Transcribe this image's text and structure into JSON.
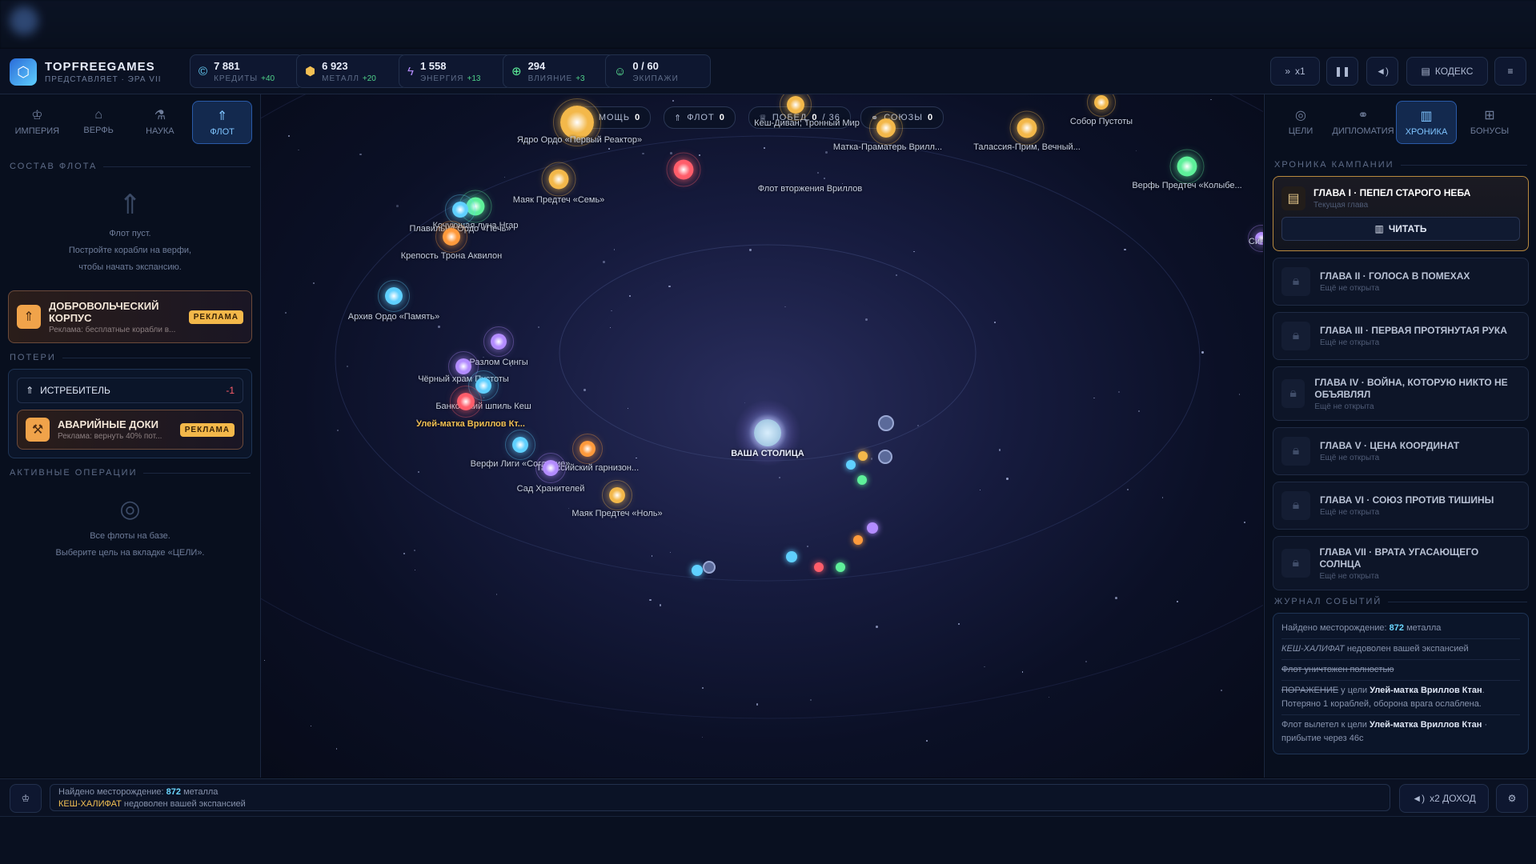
{
  "header": {
    "brand": "TOPFREEGAMES",
    "brand_sub": "ПРЕДСТАВЛЯЕТ · ЭРА VII",
    "resources": [
      {
        "icon": "credits-icon",
        "value": "7 881",
        "label": "КРЕДИТЫ",
        "delta": "+40",
        "color": "#6ad6ff"
      },
      {
        "icon": "metal-icon",
        "value": "6 923",
        "label": "МЕТАЛЛ",
        "delta": "+20",
        "color": "#f3c053"
      },
      {
        "icon": "energy-icon",
        "value": "1 558",
        "label": "ЭНЕРГИЯ",
        "delta": "+13",
        "color": "#b38cff"
      },
      {
        "icon": "influence-icon",
        "value": "294",
        "label": "ВЛИЯНИЕ",
        "delta": "+3",
        "color": "#5ef09a"
      },
      {
        "icon": "crews-icon",
        "value": "0 / 60",
        "label": "ЭКИПАЖИ",
        "delta": "",
        "color": "#5ef09a"
      }
    ],
    "speed": "x1",
    "codex": "КОДЕКС"
  },
  "left": {
    "tabs": [
      {
        "label": "ИМПЕРИЯ",
        "icon": "crown-icon",
        "active": false
      },
      {
        "label": "ВЕРФЬ",
        "icon": "shipyard-icon",
        "active": false
      },
      {
        "label": "НАУКА",
        "icon": "flask-icon",
        "active": false
      },
      {
        "label": "ФЛОТ",
        "icon": "rocket-icon",
        "active": true
      }
    ],
    "fleet_title": "СОСТАВ ФЛОТА",
    "fleet_empty": [
      "Флот пуст.",
      "Постройте корабли на верфи,",
      "чтобы начать экспансию."
    ],
    "promo": {
      "title": "ДОБРОВОЛЬЧЕСКИЙ КОРПУС",
      "sub": "Реклама: бесплатные корабли в...",
      "badge": "РЕКЛАМА"
    },
    "losses_title": "ПОТЕРИ",
    "loss": {
      "name": "ИСТРЕБИТЕЛЬ",
      "count": "-1"
    },
    "docks": {
      "title": "АВАРИЙНЫЕ ДОКИ",
      "sub": "Реклама: вернуть 40% пот...",
      "badge": "РЕКЛАМА"
    },
    "ops_title": "АКТИВНЫЕ ОПЕРАЦИИ",
    "ops_empty": [
      "Все флоты на базе.",
      "Выберите цель на вкладке «ЦЕЛИ»."
    ]
  },
  "map": {
    "chips": [
      {
        "label": "МОЩЬ",
        "value": "0",
        "extra": ""
      },
      {
        "label": "ФЛОТ",
        "value": "0",
        "extra": ""
      },
      {
        "label": "ПОБЕД",
        "value": "0",
        "extra": "/ 36"
      },
      {
        "label": "СОЮЗЫ",
        "value": "0",
        "extra": ""
      }
    ],
    "capital": "ВАША СТОЛИЦА",
    "nodes": [
      {
        "label": "Кеш-Диван, Тронный Мир",
        "color": "#f3b84a"
      },
      {
        "label": "Ядро Ордо «Первый Реактор»",
        "color": "#f3b84a"
      },
      {
        "label": "Собор Пустоты",
        "color": "#f3b84a"
      },
      {
        "label": "Матка-Праматерь Врилл...",
        "color": "#f3b84a"
      },
      {
        "label": "Талассия-Прим, Вечный...",
        "color": "#f3b84a"
      },
      {
        "label": "Верфь Предтеч «Колыбе...",
        "color": "#5ef09a"
      },
      {
        "label": "Флот вторжения Вриллов",
        "color": "#ff5d6a"
      },
      {
        "label": "Маяк Предтеч «Семь»",
        "color": "#f3b84a"
      },
      {
        "label": "Кочующая луна Нгар",
        "color": "#5ef09a"
      },
      {
        "label": "Плавильня Ордо «Печь»",
        "color": "#5fd0ff"
      },
      {
        "label": "Крепость Трона Аквилон",
        "color": "#ff9a3c"
      },
      {
        "label": "Архив Ордо «Память»",
        "color": "#5fd0ff"
      },
      {
        "label": "Разлом Сингы",
        "color": "#b38cff"
      },
      {
        "label": "Чёрный храм Пустоты",
        "color": "#b38cff"
      },
      {
        "label": "Банковский шпиль Кеш",
        "color": "#5fd0ff"
      },
      {
        "label": "Улей-матка Вриллов Кт...",
        "color": "#ff5d6a"
      },
      {
        "label": "Верфи Лиги «Согласие»",
        "color": "#5fd0ff"
      },
      {
        "label": "Талассийский гарнизон...",
        "color": "#ff9a3c"
      },
      {
        "label": "Сад Хранителей",
        "color": "#b38cff"
      },
      {
        "label": "Маяк Предтеч «Ноль»",
        "color": "#f3b84a"
      },
      {
        "label": "Син",
        "color": "#b38cff"
      }
    ]
  },
  "right": {
    "tabs": [
      {
        "label": "ЦЕЛИ",
        "icon": "target-icon",
        "active": false
      },
      {
        "label": "ДИПЛОМАТИЯ",
        "icon": "handshake-icon",
        "active": false
      },
      {
        "label": "ХРОНИКА",
        "icon": "book-icon",
        "active": true
      },
      {
        "label": "БОНУСЫ",
        "icon": "gift-icon",
        "active": false
      }
    ],
    "chronicle_title": "ХРОНИКА КАМПАНИИ",
    "current": {
      "title": "ГЛАВА I · ПЕПЕЛ СТАРОГО НЕБА",
      "sub": "Текущая глава",
      "button": "ЧИТАТЬ"
    },
    "chapters": [
      {
        "title": "ГЛАВА II · ГОЛОСА В ПОМЕХАХ",
        "sub": "Ещё не открыта"
      },
      {
        "title": "ГЛАВА III · ПЕРВАЯ ПРОТЯНУТАЯ РУКА",
        "sub": "Ещё не открыта"
      },
      {
        "title": "ГЛАВА IV · ВОЙНА, КОТОРУЮ НИКТО НЕ ОБЪЯВЛЯЛ",
        "sub": "Ещё не открыта"
      },
      {
        "title": "ГЛАВА V · ЦЕНА КООРДИНАТ",
        "sub": "Ещё не открыта"
      },
      {
        "title": "ГЛАВА VI · СОЮЗ ПРОТИВ ТИШИНЫ",
        "sub": "Ещё не открыта"
      },
      {
        "title": "ГЛАВА VII · ВРАТА УГАСАЮЩЕГО СОЛНЦА",
        "sub": "Ещё не открыта"
      }
    ],
    "journal_title": "ЖУРНАЛ СОБЫТИЙ",
    "journal": {
      "j1a": "Найдено месторождение:",
      "j1b": "872",
      "j1c": "металла",
      "j2a": "КЕШ-ХАЛИФАТ",
      "j2b": "недоволен вашей экспансией",
      "j3": "Флот уничтожен полностью",
      "j4a": "ПОРАЖЕНИЕ",
      "j4b": "у цели",
      "j4c": "Улей-матка Вриллов Ктан",
      "j4d": "Потеряно 1 кораблей, оборона врага ослаблена.",
      "j5a": "Флот вылетел к цели",
      "j5b": "Улей-матка Вриллов Ктан",
      "j5c": "· прибытие через 46с"
    }
  },
  "bottom": {
    "line1a": "Найдено месторождение:",
    "line1b": "872",
    "line1c": "металла",
    "line2a": "КЕШ-ХАЛИФАТ",
    "line2b": "недоволен вашей экспансией",
    "income": "x2 ДОХОД"
  }
}
